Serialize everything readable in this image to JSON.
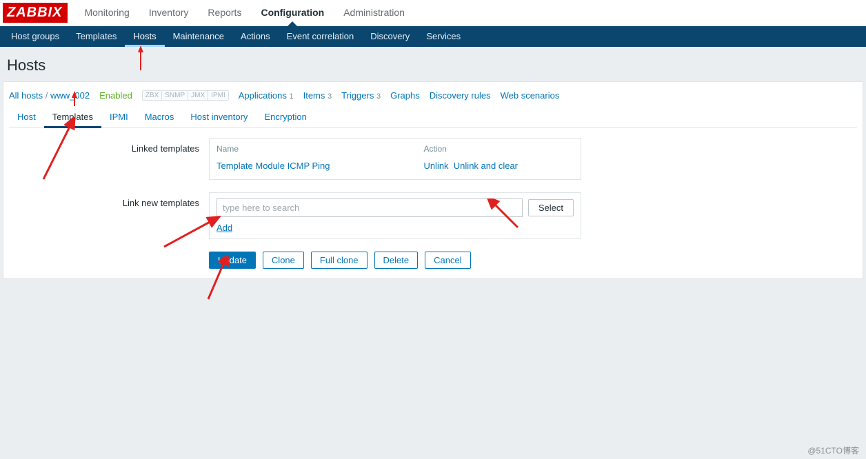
{
  "logo": "ZABBIX",
  "topnav": {
    "items": [
      "Monitoring",
      "Inventory",
      "Reports",
      "Configuration",
      "Administration"
    ],
    "active_index": 3
  },
  "subnav": {
    "items": [
      "Host groups",
      "Templates",
      "Hosts",
      "Maintenance",
      "Actions",
      "Event correlation",
      "Discovery",
      "Services"
    ],
    "active_index": 2
  },
  "page_title": "Hosts",
  "breadcrumb": {
    "all_hosts": "All hosts",
    "host": "www_002"
  },
  "status": "Enabled",
  "protocols": [
    "ZBX",
    "SNMP",
    "JMX",
    "IPMI"
  ],
  "links": [
    {
      "label": "Applications",
      "count": "1"
    },
    {
      "label": "Items",
      "count": "3"
    },
    {
      "label": "Triggers",
      "count": "3"
    },
    {
      "label": "Graphs",
      "count": ""
    },
    {
      "label": "Discovery rules",
      "count": ""
    },
    {
      "label": "Web scenarios",
      "count": ""
    }
  ],
  "tabs": {
    "items": [
      "Host",
      "Templates",
      "IPMI",
      "Macros",
      "Host inventory",
      "Encryption"
    ],
    "active_index": 1
  },
  "form": {
    "linked_label": "Linked templates",
    "linked_headers": {
      "name": "Name",
      "action": "Action"
    },
    "linked_rows": [
      {
        "name": "Template Module ICMP Ping",
        "unlink": "Unlink",
        "unlink_clear": "Unlink and clear"
      }
    ],
    "link_new_label": "Link new templates",
    "search_placeholder": "type here to search",
    "select_btn": "Select",
    "add_link": "Add"
  },
  "buttons": {
    "update": "Update",
    "clone": "Clone",
    "full_clone": "Full clone",
    "delete": "Delete",
    "cancel": "Cancel"
  },
  "watermark": "@51CTO博客"
}
